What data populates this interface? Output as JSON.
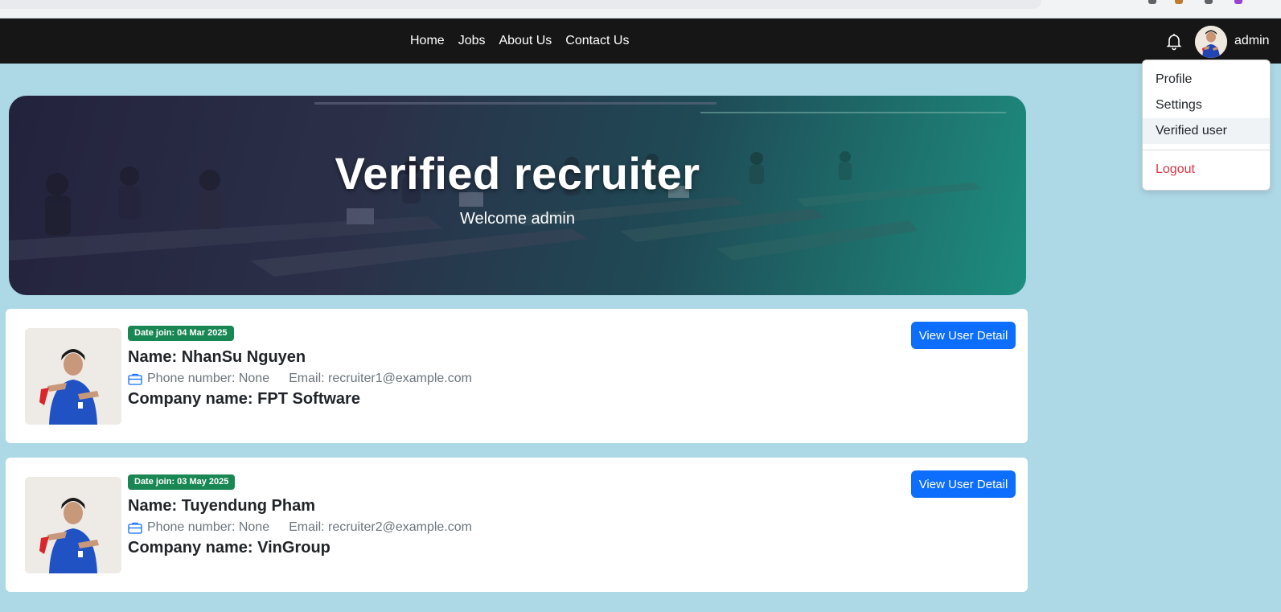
{
  "nav": {
    "links": [
      "Home",
      "Jobs",
      "About Us",
      "Contact Us"
    ],
    "username": "admin"
  },
  "dropdown": {
    "items": [
      "Profile",
      "Settings",
      "Verified user"
    ],
    "logout": "Logout",
    "active_item": "Verified user"
  },
  "hero": {
    "title": "Verified recruiter",
    "subtitle": "Welcome admin"
  },
  "recruiters": [
    {
      "date_join": "Date join: 04 Mar 2025",
      "name": "Name: NhanSu Nguyen",
      "phone": "Phone number: None",
      "email": "Email: recruiter1@example.com",
      "company": "Company name: FPT Software",
      "button": "View User Detail"
    },
    {
      "date_join": "Date join: 03 May 2025",
      "name": "Name: Tuyendung Pham",
      "phone": "Phone number: None",
      "email": "Email: recruiter2@example.com",
      "company": "Company name: VinGroup",
      "button": "View User Detail"
    }
  ],
  "colors": {
    "page_bg": "#add8e6",
    "navbar_bg": "#161616",
    "badge_green": "#198754",
    "primary_blue": "#0d6efd",
    "logout_red": "#dc3545"
  },
  "icons": [
    "bell-icon",
    "briefcase-icon",
    "avatar"
  ]
}
